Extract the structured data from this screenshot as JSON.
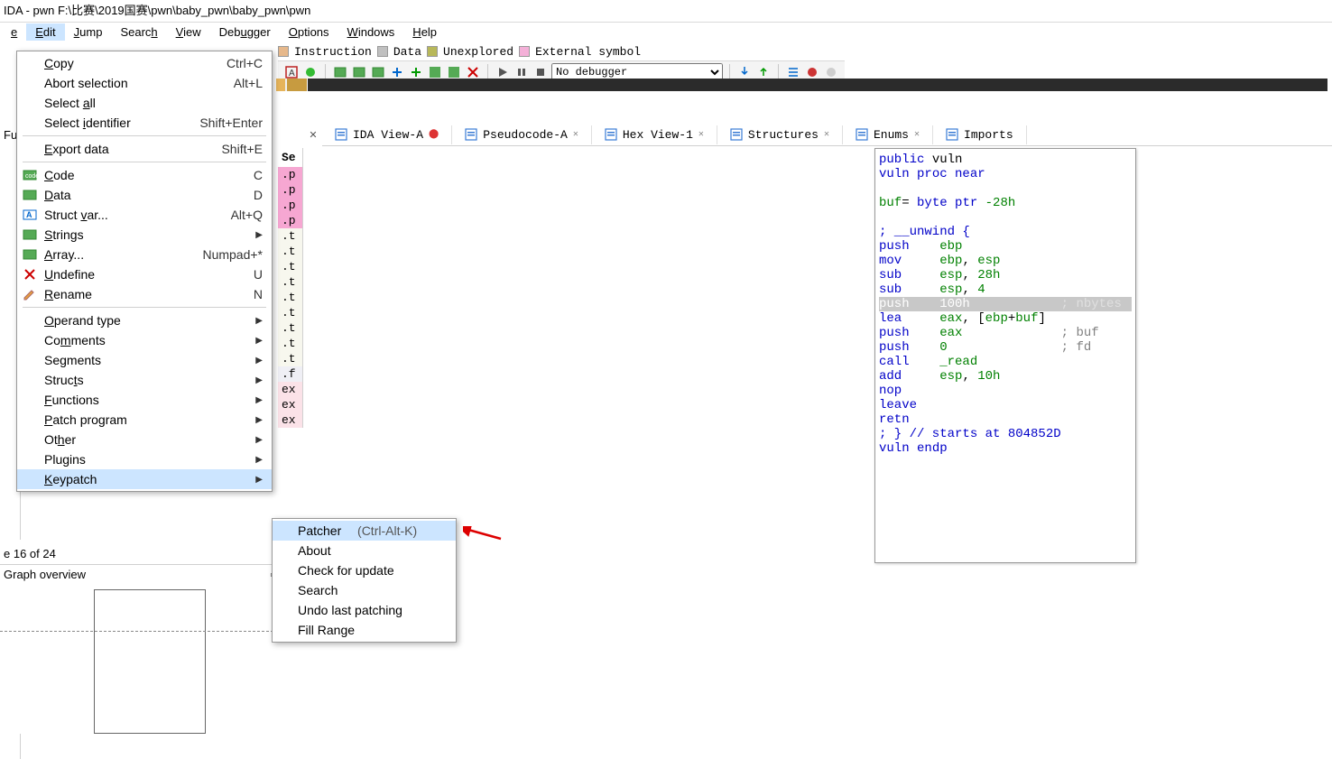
{
  "window": {
    "title": "IDA - pwn F:\\比赛\\2019国赛\\pwn\\baby_pwn\\baby_pwn\\pwn"
  },
  "menubar": {
    "items": [
      {
        "pre": "",
        "u": "e",
        "post": ""
      },
      {
        "pre": "",
        "u": "E",
        "post": "dit"
      },
      {
        "pre": "",
        "u": "J",
        "post": "ump"
      },
      {
        "pre": "Searc",
        "u": "h",
        "post": ""
      },
      {
        "pre": "",
        "u": "V",
        "post": "iew"
      },
      {
        "pre": "Deb",
        "u": "u",
        "post": "gger"
      },
      {
        "pre": "",
        "u": "O",
        "post": "ptions"
      },
      {
        "pre": "",
        "u": "W",
        "post": "indows"
      },
      {
        "pre": "",
        "u": "H",
        "post": "elp"
      }
    ],
    "active_index": 1
  },
  "toolbar": {
    "debugger_select": "No debugger"
  },
  "legend": {
    "items": [
      {
        "color": "#e6b88b",
        "label": "Instruction"
      },
      {
        "color": "#c0c0c0",
        "label": "Data"
      },
      {
        "color": "#b8b85a",
        "label": "Unexplored"
      },
      {
        "color": "#f4b0d8",
        "label": "External symbol"
      }
    ]
  },
  "tabs": [
    {
      "label": "IDA View-A",
      "closable": true,
      "active": true
    },
    {
      "label": "Pseudocode-A",
      "closable": true
    },
    {
      "label": "Hex View-1",
      "closable": true
    },
    {
      "label": "Structures",
      "closable": true
    },
    {
      "label": "Enums",
      "closable": true
    },
    {
      "label": "Imports",
      "closable": false
    }
  ],
  "segments": {
    "header": "Se",
    "rows": [
      {
        "t": ".p",
        "c": "p"
      },
      {
        "t": ".p",
        "c": "p"
      },
      {
        "t": ".p",
        "c": "p"
      },
      {
        "t": ".p",
        "c": "p"
      },
      {
        "t": ".t",
        "c": "t"
      },
      {
        "t": ".t",
        "c": "t"
      },
      {
        "t": ".t",
        "c": "t"
      },
      {
        "t": ".t",
        "c": "t"
      },
      {
        "t": ".t",
        "c": "t"
      },
      {
        "t": ".t",
        "c": "t"
      },
      {
        "t": ".t",
        "c": "t"
      },
      {
        "t": ".t",
        "c": "t"
      },
      {
        "t": ".t",
        "c": "t"
      },
      {
        "t": ".f",
        "c": "f"
      },
      {
        "t": "ex",
        "c": "e"
      },
      {
        "t": "ex",
        "c": "e"
      },
      {
        "t": "ex",
        "c": "e"
      }
    ]
  },
  "left": {
    "functions_label": "Fu",
    "line_status": "e 16 of 24",
    "graph_label": "Graph overview"
  },
  "edit_menu": {
    "sections": [
      [
        {
          "label": "Copy",
          "u": "C",
          "shortcut": "Ctrl+C"
        },
        {
          "label": "Abort selection",
          "u": null,
          "shortcut": "Alt+L"
        },
        {
          "u": "a",
          "pre": "Select ",
          "post": "ll"
        },
        {
          "u": "i",
          "pre": "Select ",
          "post": "dentifier",
          "shortcut": "Shift+Enter"
        }
      ],
      [
        {
          "label": "Export data",
          "u": "E",
          "shortcut": "Shift+E"
        }
      ],
      [
        {
          "label": "Code",
          "u": "C",
          "shortcut": "C",
          "icon": "code"
        },
        {
          "label": "Data",
          "u": "D",
          "shortcut": "D",
          "icon": "data"
        },
        {
          "pre": "Struct ",
          "u": "v",
          "post": "ar...",
          "shortcut": "Alt+Q",
          "icon": "struct"
        },
        {
          "label": "Strings",
          "u": "S",
          "arrow": true,
          "icon": "string"
        },
        {
          "label": "Array...",
          "u": "A",
          "shortcut": "Numpad+*",
          "icon": "array"
        },
        {
          "label": "Undefine",
          "u": "U",
          "shortcut": "U",
          "icon": "undef"
        },
        {
          "label": "Rename",
          "u": "R",
          "shortcut": "N",
          "icon": "rename"
        }
      ],
      [
        {
          "pre": "",
          "u": "O",
          "post": "perand type",
          "arrow": true
        },
        {
          "pre": "Co",
          "u": "m",
          "post": "ments",
          "arrow": true
        },
        {
          "pre": "Se",
          "u": "g",
          "post": "ments",
          "arrow": true
        },
        {
          "pre": "Struc",
          "u": "t",
          "post": "s",
          "arrow": true
        },
        {
          "pre": "",
          "u": "F",
          "post": "unctions",
          "arrow": true
        },
        {
          "pre": "",
          "u": "P",
          "post": "atch program",
          "arrow": true
        },
        {
          "pre": "Ot",
          "u": "h",
          "post": "er",
          "arrow": true
        },
        {
          "label": "Plugins",
          "arrow": true
        },
        {
          "pre": "",
          "u": "K",
          "post": "eypatch",
          "arrow": true,
          "hov": true
        }
      ]
    ]
  },
  "keypatch_submenu": {
    "items": [
      {
        "label": "Patcher",
        "sc": "(Ctrl-Alt-K)",
        "hov": true
      },
      {
        "label": "About"
      },
      {
        "label": "Check for update"
      },
      {
        "label": "Search"
      },
      {
        "label": "Undo last patching"
      },
      {
        "label": "Fill Range"
      }
    ]
  },
  "disassembly": {
    "lines": [
      {
        "parts": [
          {
            "t": "public ",
            "c": "kw"
          },
          {
            "t": "vuln"
          }
        ]
      },
      {
        "parts": [
          {
            "t": "vuln ",
            "c": "kw"
          },
          {
            "t": "proc near",
            "c": "kw"
          }
        ]
      },
      {
        "parts": [
          {
            "t": ""
          }
        ]
      },
      {
        "parts": [
          {
            "t": "buf",
            "c": "num"
          },
          {
            "t": "= "
          },
          {
            "t": "byte ptr ",
            "c": "kw"
          },
          {
            "t": "-28h",
            "c": "num"
          }
        ]
      },
      {
        "parts": [
          {
            "t": ""
          }
        ]
      },
      {
        "parts": [
          {
            "t": "; __unwind {",
            "c": "kw"
          }
        ]
      },
      {
        "parts": [
          {
            "t": "push    ",
            "c": "kw"
          },
          {
            "t": "ebp",
            "c": "num"
          }
        ]
      },
      {
        "parts": [
          {
            "t": "mov     ",
            "c": "kw"
          },
          {
            "t": "ebp",
            "c": "num"
          },
          {
            "t": ", "
          },
          {
            "t": "esp",
            "c": "num"
          }
        ]
      },
      {
        "parts": [
          {
            "t": "sub     ",
            "c": "kw"
          },
          {
            "t": "esp",
            "c": "num"
          },
          {
            "t": ", "
          },
          {
            "t": "28h",
            "c": "num"
          }
        ]
      },
      {
        "parts": [
          {
            "t": "sub     ",
            "c": "kw"
          },
          {
            "t": "esp",
            "c": "num"
          },
          {
            "t": ", "
          },
          {
            "t": "4",
            "c": "num"
          }
        ]
      },
      {
        "hl": true,
        "parts": [
          {
            "t": "push    100h            "
          },
          {
            "t": "; nbytes",
            "c": "hl-cm"
          }
        ]
      },
      {
        "parts": [
          {
            "t": "lea     ",
            "c": "kw"
          },
          {
            "t": "eax",
            "c": "num"
          },
          {
            "t": ", ["
          },
          {
            "t": "ebp",
            "c": "num"
          },
          {
            "t": "+"
          },
          {
            "t": "buf",
            "c": "num"
          },
          {
            "t": "]"
          }
        ]
      },
      {
        "parts": [
          {
            "t": "push    ",
            "c": "kw"
          },
          {
            "t": "eax",
            "c": "num"
          },
          {
            "t": "             "
          },
          {
            "t": "; buf",
            "c": "cm"
          }
        ]
      },
      {
        "parts": [
          {
            "t": "push    ",
            "c": "kw"
          },
          {
            "t": "0",
            "c": "num"
          },
          {
            "t": "               "
          },
          {
            "t": "; fd",
            "c": "cm"
          }
        ]
      },
      {
        "parts": [
          {
            "t": "call    ",
            "c": "kw"
          },
          {
            "t": "_read",
            "c": "num"
          }
        ]
      },
      {
        "parts": [
          {
            "t": "add     ",
            "c": "kw"
          },
          {
            "t": "esp",
            "c": "num"
          },
          {
            "t": ", "
          },
          {
            "t": "10h",
            "c": "num"
          }
        ]
      },
      {
        "parts": [
          {
            "t": "nop",
            "c": "kw"
          }
        ]
      },
      {
        "parts": [
          {
            "t": "leave",
            "c": "kw"
          }
        ]
      },
      {
        "parts": [
          {
            "t": "retn",
            "c": "kw"
          }
        ]
      },
      {
        "parts": [
          {
            "t": "; } // starts at 804852D",
            "c": "kw"
          }
        ]
      },
      {
        "parts": [
          {
            "t": "vuln ",
            "c": "kw"
          },
          {
            "t": "endp",
            "c": "kw"
          }
        ]
      }
    ]
  }
}
